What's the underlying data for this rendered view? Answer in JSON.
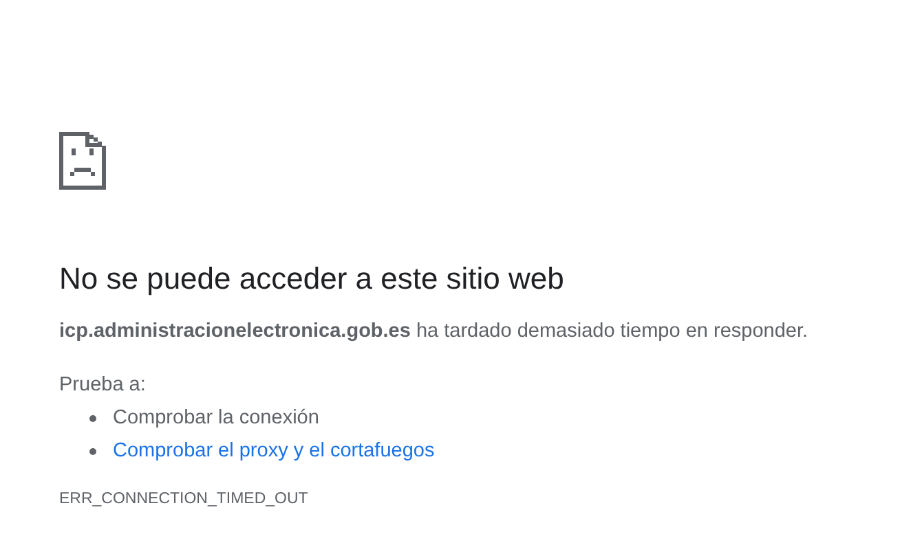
{
  "heading": "No se puede acceder a este sitio web",
  "message": "**icp.administracionelectronica.gob.es** ha tardado demasiado tiempo en responder.",
  "suggestions_label": "Prueba a:",
  "suggestions": [
    {
      "kind": "text",
      "label": "Comprobar la conexión"
    },
    {
      "kind": "link",
      "label": "Comprobar el proxy y el cortafuegos"
    }
  ],
  "error_code": "ERR_CONNECTION_TIMED_OUT"
}
